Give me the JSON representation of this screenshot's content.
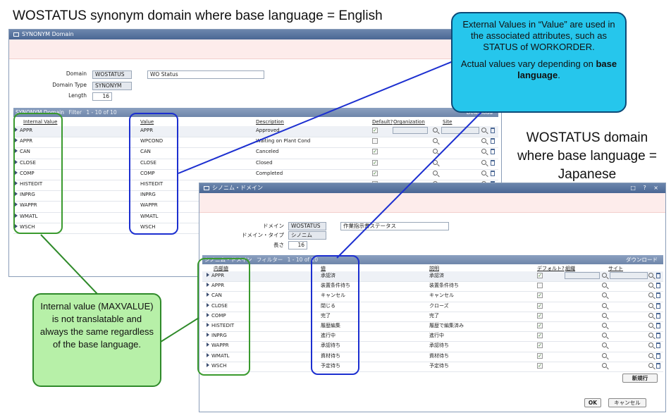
{
  "page_title": "WOSTATUS synonym domain where base language = English",
  "callouts": {
    "external_line1": "External Values in “Value” are used in the associated attributes, such as STATUS of WORKORDER.",
    "external_line2_prefix": "Actual values vary depending on ",
    "external_line2_bold": "base language",
    "external_line2_suffix": ".",
    "japanese_domain": "WOSTATUS domain where base language = Japanese",
    "internal_value": "Internal value (MAXVALUE) is not translatable and always the same regardless of the base language."
  },
  "english_window": {
    "title": "SYNONYM Domain",
    "domain_label": "Domain",
    "domain_value": "WOSTATUS",
    "domain_description": "WO Status",
    "domain_type_label": "Domain Type",
    "domain_type_value": "SYNONYM",
    "length_label": "Length",
    "length_value": "16",
    "table_title": "SYNONYM Domain",
    "filter_label": "Filter",
    "pagination": "1 - 10 of 10",
    "download_label": "Download",
    "columns": {
      "internal_value": "Internal Value",
      "value": "Value",
      "description": "Description",
      "default": "Default?",
      "organization": "Organization",
      "site": "Site"
    },
    "rows": [
      {
        "internal": "APPR",
        "value": "APPR",
        "description": "Approved",
        "default": true
      },
      {
        "internal": "APPR",
        "value": "WPCOND",
        "description": "Waiting on Plant Cond",
        "default": false
      },
      {
        "internal": "CAN",
        "value": "CAN",
        "description": "Canceled",
        "default": true
      },
      {
        "internal": "CLOSE",
        "value": "CLOSE",
        "description": "Closed",
        "default": true
      },
      {
        "internal": "COMP",
        "value": "COMP",
        "description": "Completed",
        "default": true
      },
      {
        "internal": "HISTEDIT",
        "value": "HISTEDIT",
        "description": "",
        "default": true
      },
      {
        "internal": "INPRG",
        "value": "INPRG",
        "description": "",
        "default": true
      },
      {
        "internal": "WAPPR",
        "value": "WAPPR",
        "description": "",
        "default": true
      },
      {
        "internal": "WMATL",
        "value": "WMATL",
        "description": "",
        "default": true
      },
      {
        "internal": "WSCH",
        "value": "WSCH",
        "description": "",
        "default": true
      }
    ]
  },
  "japanese_window": {
    "title": "シノニム・ドメイン",
    "domain_label": "ドメイン",
    "domain_value": "WOSTATUS",
    "domain_description": "作業指示書ステータス",
    "domain_type_label": "ドメイン・タイプ",
    "domain_type_value": "シノニム",
    "length_label": "長さ",
    "length_value": "16",
    "table_title": "シノニム・ドメイン",
    "filter_label": "フィルター",
    "pagination": "1 - 10 of 10",
    "download_label": "ダウンロード",
    "columns": {
      "internal_value": "内部値",
      "value": "値",
      "description": "説明",
      "default": "デフォルト?",
      "organization": "組織",
      "site": "サイト"
    },
    "rows": [
      {
        "internal": "APPR",
        "value": "承認済",
        "description": "承認済",
        "default": true
      },
      {
        "internal": "APPR",
        "value": "装置条件待ち",
        "description": "装置条件待ち",
        "default": false
      },
      {
        "internal": "CAN",
        "value": "キャンセル",
        "description": "キャンセル",
        "default": true
      },
      {
        "internal": "CLOSE",
        "value": "閉じる",
        "description": "クローズ",
        "default": true
      },
      {
        "internal": "COMP",
        "value": "完了",
        "description": "完了",
        "default": true
      },
      {
        "internal": "HISTEDIT",
        "value": "履歴編集",
        "description": "履歴で編集済み",
        "default": true
      },
      {
        "internal": "INPRG",
        "value": "進行中",
        "description": "進行中",
        "default": true
      },
      {
        "internal": "WAPPR",
        "value": "承認待ち",
        "description": "承認待ち",
        "default": true
      },
      {
        "internal": "WMATL",
        "value": "資材待ち",
        "description": "資材待ち",
        "default": true
      },
      {
        "internal": "WSCH",
        "value": "予定待ち",
        "description": "予定待ち",
        "default": true
      }
    ],
    "new_row_button": "新規行",
    "ok_button": "OK",
    "cancel_button": "キャンセル"
  },
  "colors": {
    "highlight_green": "#3a9a2e",
    "highlight_blue": "#1c2fd0",
    "callout_blue_fill": "#26c6ec",
    "callout_green_fill": "#b7f0a8",
    "titlebar": "#4a6794",
    "connector": "#1c2fd0"
  },
  "icons": [
    "window-icon",
    "magnifier-icon",
    "trash-icon",
    "row-expand-icon",
    "checkbox-icon",
    "sort-arrow-icon"
  ]
}
